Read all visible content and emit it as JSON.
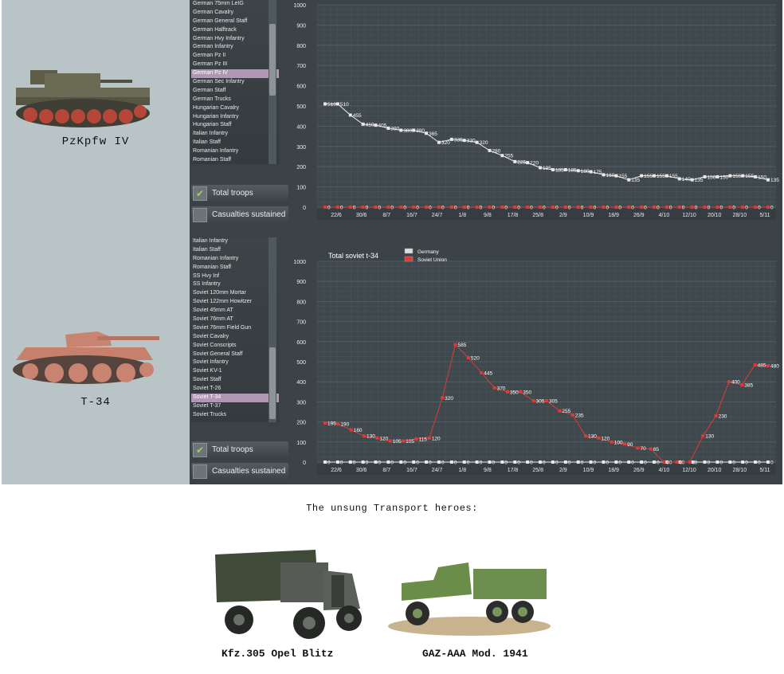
{
  "left": {
    "vehicle1": {
      "caption": "PzKpfw IV"
    },
    "vehicle2": {
      "caption": "T-34"
    }
  },
  "panel1": {
    "list_items": [
      "German 75mm LeIG",
      "German Cavalry",
      "German General Staff",
      "German Halftrack",
      "German Hvy Infantry",
      "German Infantry",
      "German Pz II",
      "German Pz III",
      "German Pz IV",
      "German Sec Infantry",
      "German Staff",
      "German Trucks",
      "Hungarian Cavalry",
      "Hungarian Infantry",
      "Hungarian Staff",
      "Italian Infantry",
      "Italian Staff",
      "Romanian Infantry",
      "Romanian Staff"
    ],
    "selected_index": 8,
    "tab_total": "Total troops",
    "tab_casualties": "Casualties sustained",
    "chart_data": {
      "type": "line",
      "ylim": [
        0,
        1000
      ],
      "yticks": [
        0,
        100,
        200,
        300,
        400,
        500,
        600,
        700,
        800,
        900,
        1000
      ],
      "x_tick_labels": [
        "22/6",
        "30/6",
        "8/7",
        "16/7",
        "24/7",
        "1/8",
        "9/8",
        "17/8",
        "25/8",
        "2/9",
        "10/9",
        "18/9",
        "26/9",
        "4/10",
        "12/10",
        "20/10",
        "28/10",
        "5/11"
      ],
      "series": [
        {
          "color": "#e8e8e8",
          "values": [
            510,
            510,
            455,
            410,
            405,
            390,
            380,
            380,
            365,
            320,
            335,
            330,
            320,
            280,
            255,
            225,
            220,
            195,
            185,
            185,
            180,
            175,
            160,
            155,
            135,
            155,
            155,
            155,
            140,
            135,
            150,
            150,
            155,
            155,
            150,
            135
          ]
        },
        {
          "color": "#e03a36",
          "values": [
            0,
            0,
            0,
            0,
            0,
            0,
            0,
            0,
            0,
            0,
            0,
            0,
            0,
            0,
            0,
            0,
            0,
            0,
            0,
            0,
            0,
            0,
            0,
            0,
            0,
            0,
            0,
            0,
            0,
            0,
            0,
            0,
            0,
            0,
            0,
            0
          ]
        }
      ]
    }
  },
  "panel2": {
    "list_items": [
      "Italian Infantry",
      "Italian Staff",
      "Romanian Infantry",
      "Romanian Staff",
      "SS Hvy Inf",
      "SS Infantry",
      "Soviet 120mm Mortar",
      "Soviet 122mm Howitzer",
      "Soviet 45mm AT",
      "Soviet 76mm AT",
      "Soviet 76mm Field Gun",
      "Soviet Cavalry",
      "Soviet Conscripts",
      "Soviet General Staff",
      "Soviet Infantry",
      "Soviet KV-1",
      "Soviet Staff",
      "Soviet T-26",
      "Soviet T-34",
      "Soviet T-37",
      "Soviet Trucks"
    ],
    "selected_index": 18,
    "tab_total": "Total troops",
    "tab_casualties": "Casualties sustained",
    "chart_data": {
      "type": "line",
      "title": "Total soviet t-34",
      "legend": [
        "Germany",
        "Soviet Union"
      ],
      "legend_colors": [
        "#dddddd",
        "#e03a36"
      ],
      "ylim": [
        0,
        1000
      ],
      "yticks": [
        0,
        100,
        200,
        300,
        400,
        500,
        600,
        700,
        800,
        900,
        1000
      ],
      "x_tick_labels": [
        "22/6",
        "30/6",
        "8/7",
        "16/7",
        "24/7",
        "1/8",
        "9/8",
        "17/8",
        "25/8",
        "2/9",
        "10/9",
        "18/9",
        "26/9",
        "4/10",
        "12/10",
        "20/10",
        "28/10",
        "5/11"
      ],
      "series": [
        {
          "name": "Germany",
          "color": "#e8e8e8",
          "values": [
            0,
            0,
            0,
            0,
            0,
            0,
            0,
            0,
            0,
            0,
            0,
            0,
            0,
            0,
            0,
            0,
            0,
            0,
            0,
            0,
            0,
            0,
            0,
            0,
            0,
            0,
            0,
            0,
            0,
            0,
            0,
            0,
            0,
            0,
            0,
            0
          ]
        },
        {
          "name": "Soviet Union",
          "color": "#e03a36",
          "values": [
            195,
            190,
            160,
            130,
            120,
            105,
            105,
            115,
            120,
            320,
            585,
            520,
            445,
            370,
            350,
            350,
            305,
            305,
            255,
            235,
            130,
            120,
            100,
            90,
            70,
            65,
            0,
            0,
            0,
            130,
            230,
            400,
            385,
            485,
            480
          ]
        }
      ]
    }
  },
  "footer": {
    "title": "The unsung Transport heroes:",
    "truck1": "Kfz.305 Opel Blitz",
    "truck2": "GAZ-AAA Mod. 1941"
  }
}
